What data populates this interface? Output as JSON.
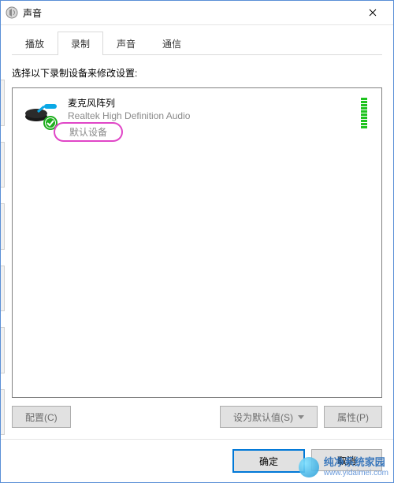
{
  "window": {
    "title": "声音"
  },
  "tabs": [
    {
      "label": "播放",
      "active": false
    },
    {
      "label": "录制",
      "active": true
    },
    {
      "label": "声音",
      "active": false
    },
    {
      "label": "通信",
      "active": false
    }
  ],
  "instruction": "选择以下录制设备来修改设置:",
  "device": {
    "name": "麦克风阵列",
    "subtitle": "Realtek High Definition Audio",
    "status": "默认设备",
    "meter_bars": 10
  },
  "buttons": {
    "configure": "配置(C)",
    "set_default": "设为默认值(S)",
    "properties": "属性(P)",
    "ok": "确定",
    "cancel": "取消"
  },
  "watermark": {
    "main": "纯净系统家园",
    "sub": "www.yidaimei.com"
  }
}
